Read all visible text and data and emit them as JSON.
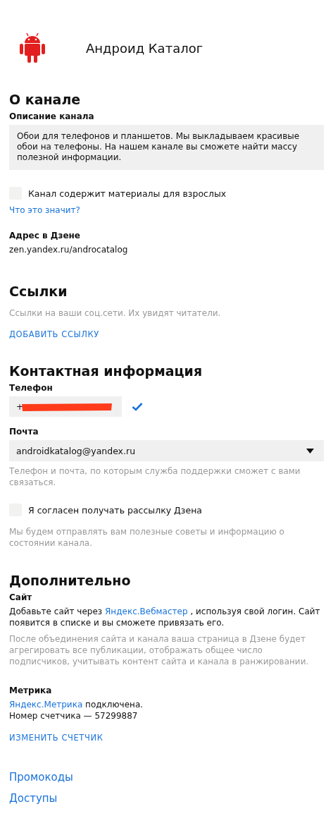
{
  "channel": {
    "name": "Андроид Каталог"
  },
  "about": {
    "title": "О канале",
    "description_label": "Описание канала",
    "description": "Обои для телефонов и планшетов. Мы выкладываем красивые обои на телефоны. На нашем канале вы сможете найти массу полезной информации.",
    "adult": {
      "label": "Канал содержит материалы для взрослых",
      "checked": false
    },
    "adult_help": "Что это значит?",
    "address_label": "Адрес в Дзене",
    "address": "zen.yandex.ru/androcatalog"
  },
  "links": {
    "title": "Ссылки",
    "hint": "Ссылки на ваши соц.сети. Их увидят читатели.",
    "add": "ДОБАВИТЬ ССЫЛКУ"
  },
  "contacts": {
    "title": "Контактная информация",
    "phone_label": "Телефон",
    "phone": {
      "value": "+",
      "verified": true
    },
    "email_label": "Почта",
    "email": "androidkatalog@yandex.ru",
    "hint": "Телефон и почта, по которым служба поддержки сможет с вами связаться.",
    "newsletter": {
      "label": "Я согласен получать рассылку Дзена",
      "checked": false
    },
    "newsletter_hint": "Мы будем отправлять вам полезные советы и информацию о состоянии канала."
  },
  "extra": {
    "title": "Дополнительно",
    "site_label": "Сайт",
    "site_text_before": "Добавьте сайт через",
    "site_link": "Яндекс.Вебмастер",
    "site_text_after": ", используя свой логин. Сайт появится в списке и вы сможете привязать его.",
    "site_hint": "После объединения сайта и канала ваша страница в Дзене будет агрегировать все публикации, отображать общее число подписчиков, учитывать контент сайта и канала в ранжировании.",
    "metrika_label": "Метрика",
    "metrika_link": "Яндекс.Метрика",
    "metrika_status": "подключена.",
    "counter": "Номер счетчика — 57299887",
    "change": "ИЗМЕНИТЬ СЧЕТЧИК"
  },
  "footer_links": [
    "Промокоды",
    "Доступы"
  ]
}
